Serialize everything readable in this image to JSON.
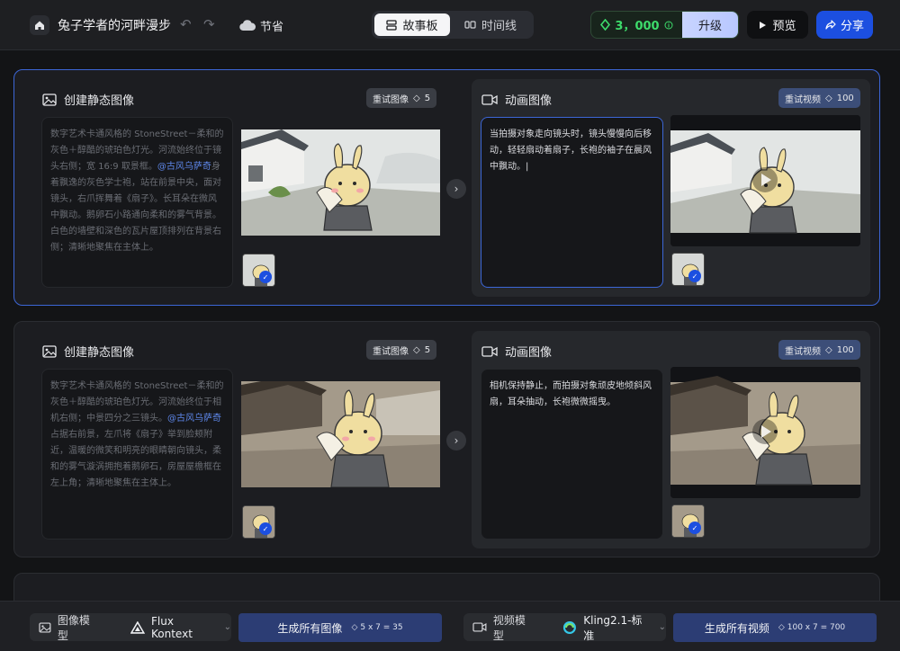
{
  "header": {
    "title": "兔子学者的河畔漫步",
    "save_label": "节省",
    "tabs": [
      {
        "label": "故事板",
        "active": true
      },
      {
        "label": "时间线",
        "active": false
      }
    ],
    "credits": "3，000",
    "upgrade_label": "升级",
    "preview_label": "预览",
    "share_label": "分享"
  },
  "scenes": [
    {
      "image_panel": {
        "title": "创建静态图像",
        "retry_label": "重试图像",
        "retry_cost": "5",
        "prompt_before": "数字艺术卡通风格的 StoneStreet－柔和的灰色＋醇酷的琥珀色灯光。河流始终位于镜头右侧；宽 16:9 取景框。",
        "mention": "@古风乌萨奇",
        "prompt_after": "身着飘逸的灰色学士袍，站在前景中央，面对镜头，右爪挥舞着《扇子》。长耳朵在微风中飘动。鹅卵石小路通向柔和的雾气背景。白色的墙壁和深色的瓦片屋顶排列在背景右侧；清晰地聚焦在主体上。"
      },
      "anim_panel": {
        "title": "动画图像",
        "retry_label": "重试视频",
        "retry_cost": "100",
        "prompt": "当拍摄对象走向镜头时，镜头慢慢向后移动，轻轻扇动着扇子，长袍的袖子在晨风中飘动。"
      }
    },
    {
      "image_panel": {
        "title": "创建静态图像",
        "retry_label": "重试图像",
        "retry_cost": "5",
        "prompt_before": "数字艺术卡通风格的 StoneStreet－柔和的灰色＋醇酷的琥珀色灯光。河流始终位于相机右侧；中景四分之三镜头。",
        "mention": "@古风乌萨奇",
        "prompt_after": "占据右前景，左爪将《扇子》举到脸颊附近，温暖的微笑和明亮的眼睛朝向镜头，柔和的雾气漩涡拥抱着鹅卵石，房屋屋檐框在左上角；清晰地聚焦在主体上。"
      },
      "anim_panel": {
        "title": "动画图像",
        "retry_label": "重试视频",
        "retry_cost": "100",
        "prompt": "相机保持静止，而拍摄对象顽皮地倾斜风扇，耳朵抽动，长袍微微摇曳。"
      }
    }
  ],
  "footer": {
    "image_model_label": "图像模型",
    "image_model_value": "Flux Kontext",
    "gen_images_label": "生成所有图像",
    "gen_images_cost": "5 x 7 = 35",
    "video_model_label": "视频模型",
    "video_model_value": "Kling2.1-标准",
    "gen_videos_label": "生成所有视频",
    "gen_videos_cost": "100 x 7 = 700"
  },
  "colors": {
    "accent": "#1c4fe0",
    "credit_green": "#3ddc6b",
    "selected_border": "#3c66d6"
  }
}
